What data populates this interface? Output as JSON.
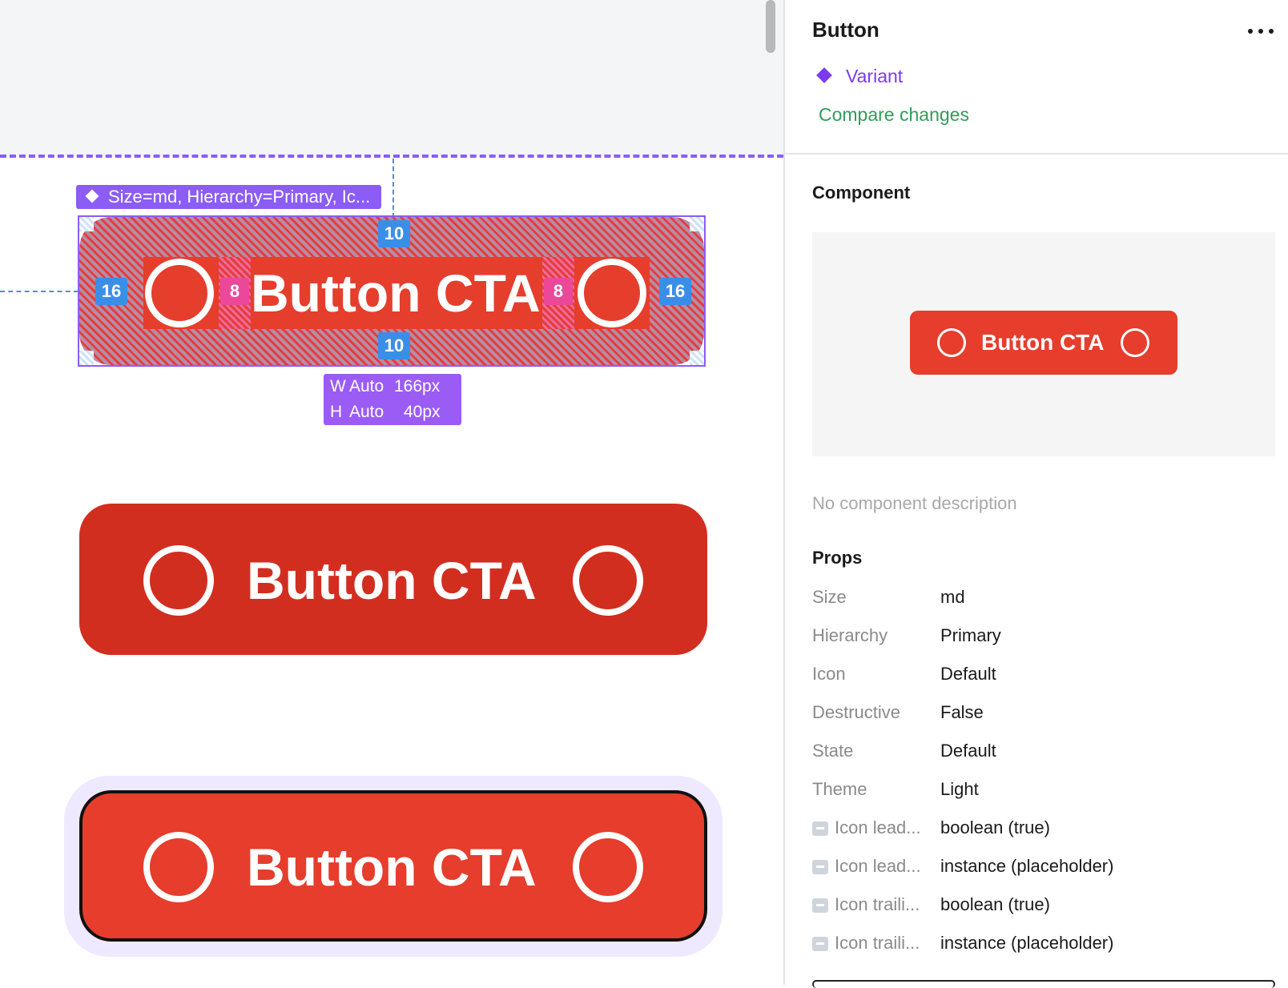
{
  "canvas": {
    "selection_tag": "Size=md, Hierarchy=Primary, Ic...",
    "spacing": {
      "top": "10",
      "bottom": "10",
      "left": "16",
      "right": "16",
      "gap_left": "8",
      "gap_right": "8"
    },
    "button_label": "Button CTA",
    "dimensions": {
      "w_key": "W",
      "w_mode": "Auto",
      "w_val": "166px",
      "h_key": "H",
      "h_mode": "Auto",
      "h_val": "40px"
    },
    "colors": {
      "selection": "#8b5cf6",
      "spacing_badge": "#3b8ee8",
      "gap_badge": "#ec4899",
      "button": "#e63d2c",
      "button_hover": "#d22e20"
    }
  },
  "panel": {
    "title": "Button",
    "variant_label": "Variant",
    "compare_label": "Compare changes",
    "component_title": "Component",
    "preview_label": "Button CTA",
    "no_description": "No component description",
    "props_title": "Props",
    "props": [
      {
        "key": "Size",
        "value": "md"
      },
      {
        "key": "Hierarchy",
        "value": "Primary"
      },
      {
        "key": "Icon",
        "value": "Default"
      },
      {
        "key": "Destructive",
        "value": "False"
      },
      {
        "key": "State",
        "value": "Default"
      },
      {
        "key": "Theme",
        "value": "Light"
      },
      {
        "key": "Icon lead...",
        "value": "boolean (true)",
        "icon": "arrow-left-icon"
      },
      {
        "key": "Icon lead...",
        "value": "instance (placeholder)",
        "icon": "swap-icon"
      },
      {
        "key": "Icon traili...",
        "value": "boolean (true)",
        "icon": "arrow-right-icon"
      },
      {
        "key": "Icon traili...",
        "value": "instance (placeholder)",
        "icon": "swap-icon"
      }
    ]
  }
}
